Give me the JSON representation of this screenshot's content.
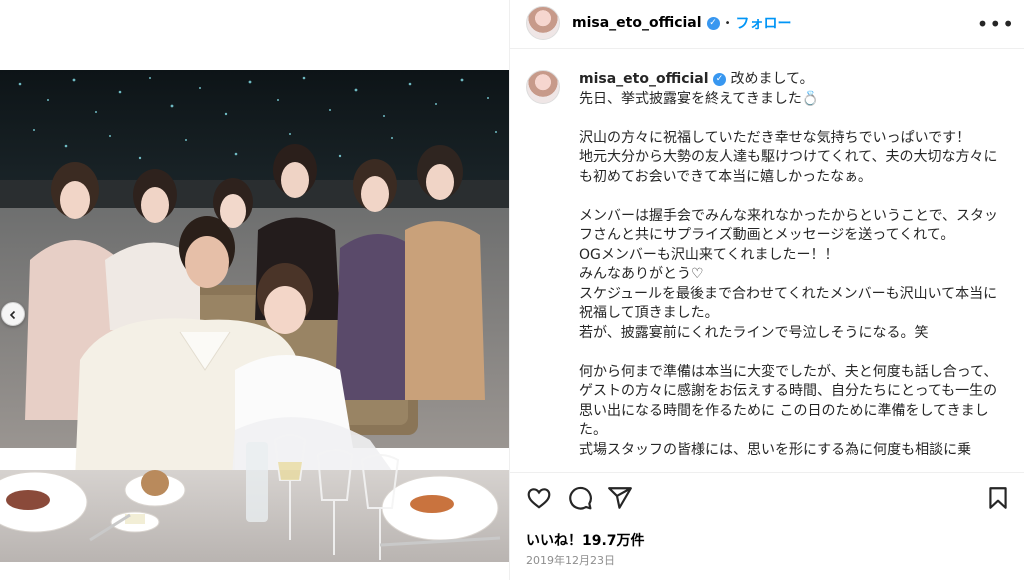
{
  "post": {
    "username": "misa_eto_official",
    "follow_label": "フォロー",
    "separator": "•",
    "more_icon": "more-horizontal-icon"
  },
  "caption": {
    "username": "misa_eto_official",
    "first_line": "改めまして。",
    "body": "先日、挙式披露宴を終えてきました💍\n\n沢山の方々に祝福していただき幸せな気持ちでいっぱいです！\n地元大分から大勢の友人達も駆けつけてくれて、夫の大切な方々にも初めてお会いできて本当に嬉しかったなぁ。\n\nメンバーは握手会でみんな来れなかったからということで、スタッフさんと共にサプライズ動画とメッセージを送ってくれて。\nOGメンバーも沢山来てくれましたー！！\nみんなありがとう♡\nスケジュールを最後まで合わせてくれたメンバーも沢山いて本当に祝福して頂きました。\n若が、披露宴前にくれたラインで号泣しそうになる。笑\n\n何から何まで準備は本当に大変でしたが、夫と何度も話し合って、ゲストの方々に感謝をお伝えする時間、自分たちにとっても一生の思い出になる時間を作るために この日のために準備をしてきました。\n式場スタッフの皆様には、思いを形にする為に何度も相談に乗"
  },
  "actions": {
    "like_icon": "heart-icon",
    "comment_icon": "comment-icon",
    "share_icon": "share-icon",
    "save_icon": "bookmark-icon"
  },
  "likes_label": "いいね！19.7万件",
  "date": "2019年12月23日",
  "colors": {
    "accent": "#0095f6",
    "verified": "#3897f0",
    "muted": "#8e8e8e"
  }
}
